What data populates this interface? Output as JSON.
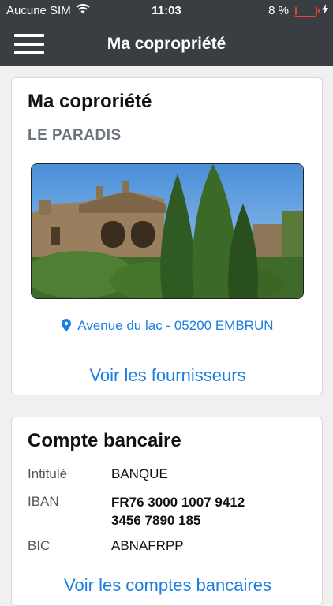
{
  "status": {
    "carrier": "Aucune SIM",
    "time": "11:03",
    "battery_text": "8 %",
    "battery_level": 0.08,
    "battery_color": "#e04343"
  },
  "nav": {
    "title": "Ma copropriété",
    "menu_icon": "hamburger-icon"
  },
  "property": {
    "heading": "Ma coproriété",
    "name": "LE PARADIS",
    "address": "Avenue du lac - 05200 EMBRUN",
    "address_icon": "map-pin-icon",
    "suppliers_link": "Voir les fournisseurs"
  },
  "bank": {
    "heading": "Compte bancaire",
    "label_title": "Intitulé",
    "title_value": "BANQUE",
    "label_iban": "IBAN",
    "iban_line1": "FR76 3000 1007 9412",
    "iban_line2": "3456 7890 185",
    "label_bic": "BIC",
    "bic_value": "ABNAFRPP",
    "accounts_link": "Voir les comptes bancaires"
  },
  "colors": {
    "header_bg": "#3a3d42",
    "link": "#1a7fe0"
  }
}
